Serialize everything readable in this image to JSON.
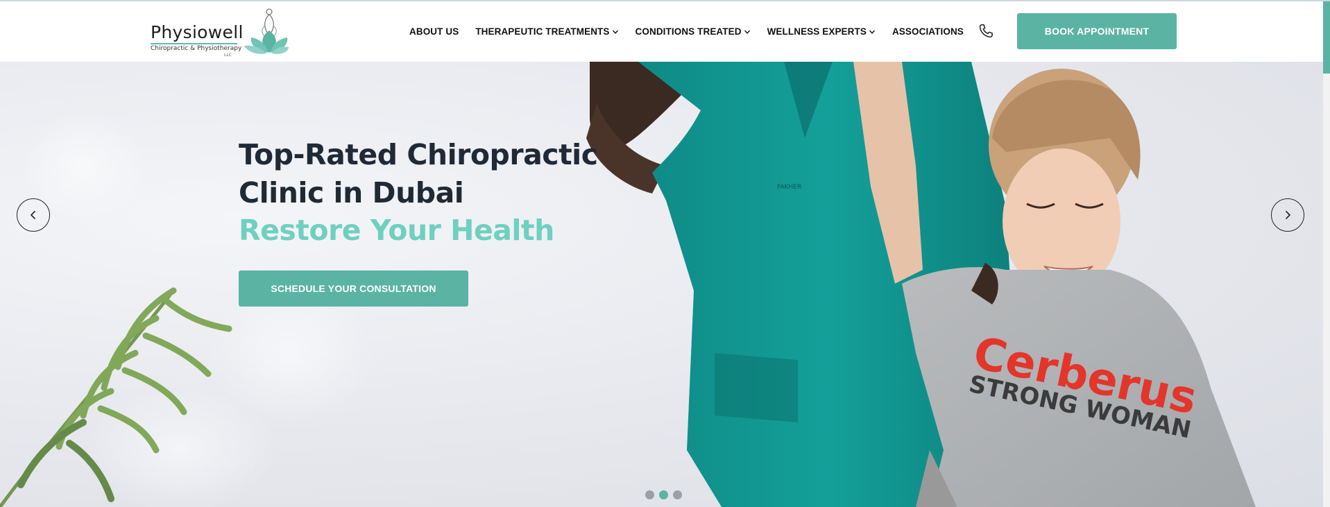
{
  "brand": {
    "name": "Physiowell",
    "tagline": "Chiropractic & Physiotherapy",
    "suffix": "LLC",
    "accent_color": "#5bb3a3",
    "highlight_color": "#6fd0c0"
  },
  "nav": {
    "items": [
      {
        "label": "ABOUT US",
        "has_dropdown": false
      },
      {
        "label": "THERAPEUTIC TREATMENTS",
        "has_dropdown": true
      },
      {
        "label": "CONDITIONS TREATED",
        "has_dropdown": true
      },
      {
        "label": "WELLNESS EXPERTS",
        "has_dropdown": true
      },
      {
        "label": "ASSOCIATIONS",
        "has_dropdown": false
      }
    ],
    "phone_icon": "phone-icon",
    "book_label": "BOOK APPOINTMENT"
  },
  "hero": {
    "title_line1": "Top-Rated Chiropractic",
    "title_line2": "Clinic in Dubai",
    "accent_line": "Restore Your Health",
    "cta_label": "SCHEDULE YOUR CONSULTATION",
    "shirt_brand": "Cerberus",
    "shirt_line": "STRONG WOMAN",
    "prev_icon": "chevron-left-icon",
    "next_icon": "chevron-right-icon",
    "slide_count": 3,
    "active_slide": 2
  }
}
